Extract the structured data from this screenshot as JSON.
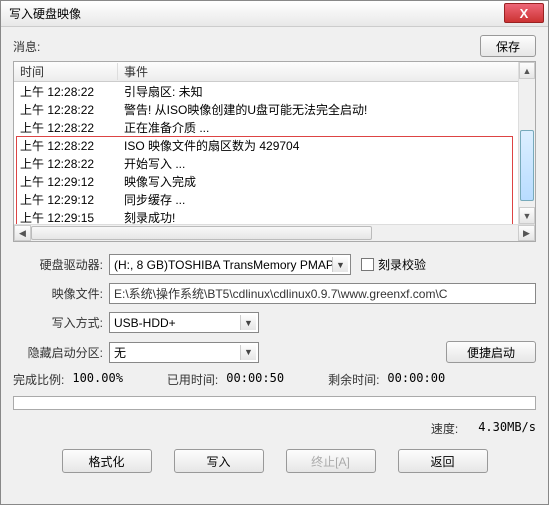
{
  "window": {
    "title": "写入硬盘映像",
    "close_icon": "X"
  },
  "msg_label": "消息:",
  "save_btn": "保存",
  "columns": {
    "time": "时间",
    "event": "事件"
  },
  "log": [
    {
      "t": "上午 12:28:22",
      "e": "引导扇区: 未知"
    },
    {
      "t": "上午 12:28:22",
      "e": "警告! 从ISO映像创建的U盘可能无法完全启动!"
    },
    {
      "t": "上午 12:28:22",
      "e": "正在准备介质 ..."
    },
    {
      "t": "上午 12:28:22",
      "e": "ISO 映像文件的扇区数为 429704"
    },
    {
      "t": "上午 12:28:22",
      "e": "开始写入 ..."
    },
    {
      "t": "上午 12:29:12",
      "e": "映像写入完成"
    },
    {
      "t": "上午 12:29:12",
      "e": "同步缓存 ..."
    },
    {
      "t": "上午 12:29:15",
      "e": "刻录成功!"
    }
  ],
  "labels": {
    "drive": "硬盘驱动器:",
    "image": "映像文件:",
    "mode": "写入方式:",
    "hidden": "隐藏启动分区:",
    "verify": "刻录校验",
    "percent": "完成比例:",
    "elapsed": "已用时间:",
    "remain": "剩余时间:",
    "speed": "速度:"
  },
  "values": {
    "drive": "(H:, 8 GB)TOSHIBA TransMemory    PMAP",
    "image": "E:\\系统\\操作系统\\BT5\\cdlinux\\cdlinux0.9.7\\www.greenxf.com\\C",
    "mode": "USB-HDD+",
    "hidden": "无",
    "percent": "100.00%",
    "elapsed": "00:00:50",
    "remain": "00:00:00",
    "speed": "4.30MB/s"
  },
  "buttons": {
    "portable": "便捷启动",
    "format": "格式化",
    "write": "写入",
    "abort": "终止[A]",
    "back": "返回"
  }
}
